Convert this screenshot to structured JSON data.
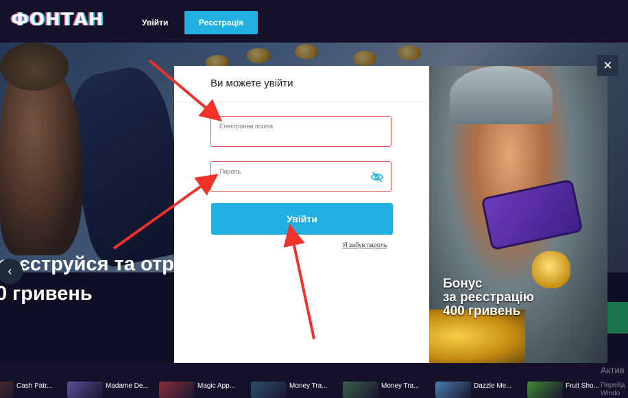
{
  "header": {
    "logo": "ФОНТАН",
    "login_label": "Увійти",
    "register_label": "Реєстрація"
  },
  "hero": {
    "headline_line1": "реєструйся та отр",
    "headline_line2": "0 гривень",
    "prev_icon": "‹"
  },
  "modal": {
    "title": "Ви можете увійти",
    "email_placeholder": "Електронна пошта",
    "password_placeholder": "Пароль",
    "submit_label": "Увійти",
    "forgot_label": "Я забув пароль",
    "close_icon": "✕"
  },
  "bonus": {
    "line1": "Бонус",
    "line2": "за реєстрацію",
    "line3": "400 гривень"
  },
  "games": [
    {
      "label": "Cash Patr...",
      "color": "#6a3b2a"
    },
    {
      "label": "Madame De...",
      "color": "#5b4f9a"
    },
    {
      "label": "Magic App...",
      "color": "#8a2f3a"
    },
    {
      "label": "Money Tra...",
      "color": "#2d4f6b"
    },
    {
      "label": "Money Tra...",
      "color": "#3a5f4a"
    },
    {
      "label": "Dazzle Me...",
      "color": "#4a7fb0"
    },
    {
      "label": "Fruit Sho...",
      "color": "#3f8a2f"
    }
  ],
  "watermark": {
    "line1": "Актив",
    "line2": "Перейд",
    "line3": "Windo"
  },
  "annotations": {
    "arrow_color": "#f0322a"
  }
}
